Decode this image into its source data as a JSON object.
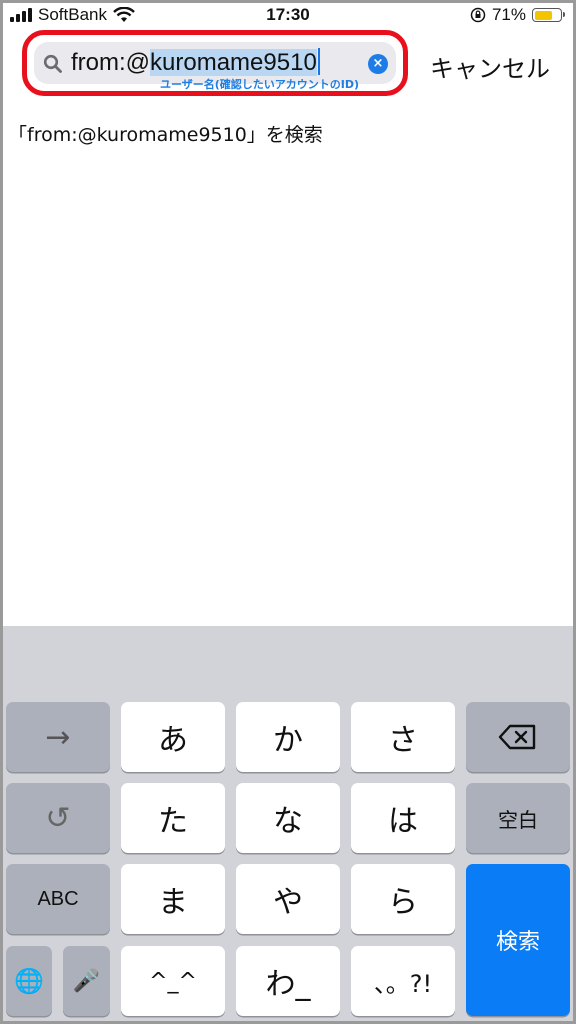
{
  "status_bar": {
    "carrier": "SoftBank",
    "time": "17:30",
    "battery_percent": "71%",
    "battery_level": 0.71
  },
  "search": {
    "prefix": "from:@",
    "selected_text": "kuromame9510",
    "annotation": "ユーザー名(確認したいアカウントのID)",
    "cancel_label": "キャンセル",
    "clear_icon": "×"
  },
  "suggestion": "「from:@kuromame9510」を検索",
  "keyboard": {
    "row1": [
      "→",
      "あ",
      "か",
      "さ",
      "⌫"
    ],
    "row2": [
      "↺",
      "た",
      "な",
      "は",
      "空白"
    ],
    "row3": [
      "ABC",
      "ま",
      "や",
      "ら",
      "検索"
    ],
    "row4": [
      "🌐",
      "🎤",
      "^_^",
      "わ_",
      "、。?!"
    ]
  },
  "colors": {
    "highlight_border": "#e8101c",
    "accent_blue": "#0a7cf5",
    "battery_yellow": "#f5c400"
  }
}
